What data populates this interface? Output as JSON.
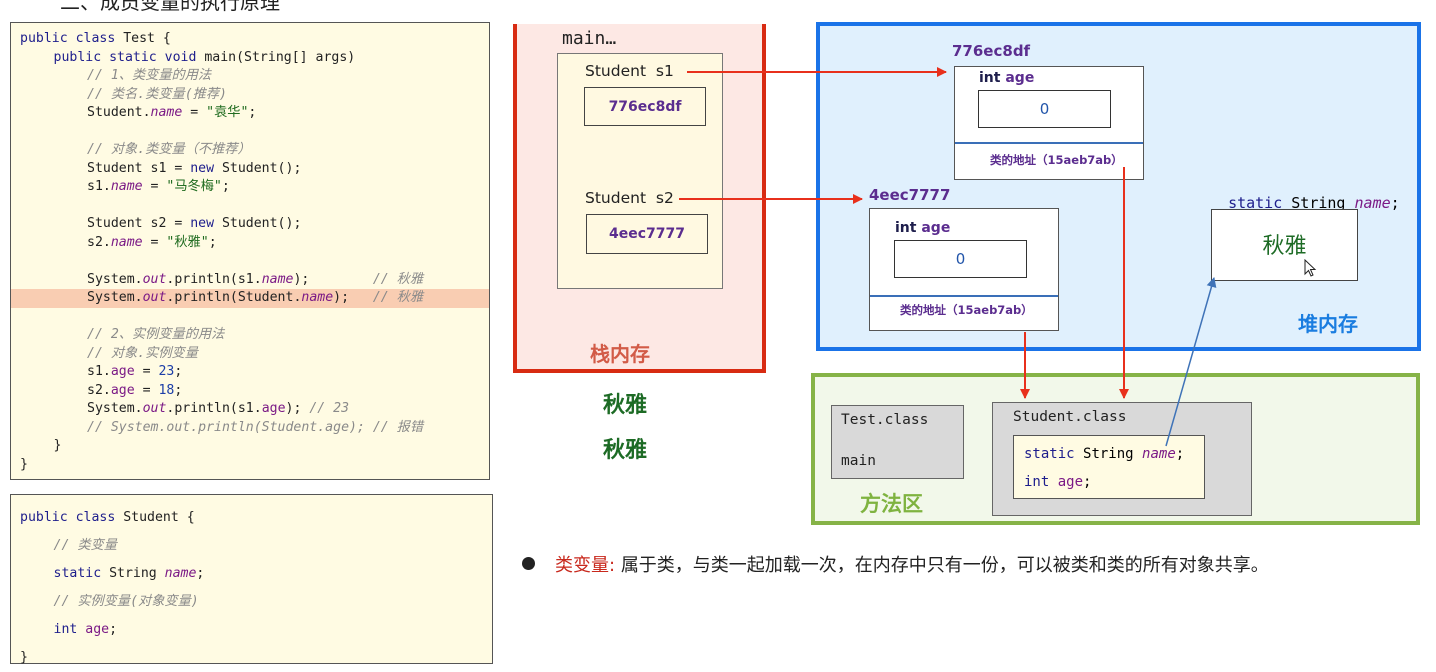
{
  "top_heading": "二、成员变量的执行原理",
  "code_test": {
    "lines": [
      {
        "indent": 0,
        "parts": [
          [
            "kw",
            "public class "
          ],
          [
            "",
            "Test {"
          ]
        ]
      },
      {
        "indent": 1,
        "parts": [
          [
            "kw",
            "public static void "
          ],
          [
            "",
            "main(String[] args)"
          ]
        ]
      },
      {
        "indent": 2,
        "parts": [
          [
            "cm",
            "// 1、类变量的用法"
          ]
        ]
      },
      {
        "indent": 2,
        "parts": [
          [
            "cm",
            "// 类名.类变量(推荐)"
          ]
        ]
      },
      {
        "indent": 2,
        "parts": [
          [
            "",
            "Student."
          ],
          [
            "fld",
            "name"
          ],
          [
            "",
            " = "
          ],
          [
            "str",
            "\"袁华\""
          ],
          [
            "",
            ";"
          ]
        ]
      },
      {
        "indent": 0,
        "parts": []
      },
      {
        "indent": 2,
        "parts": [
          [
            "cm",
            "// 对象.类变量（不推荐）"
          ]
        ]
      },
      {
        "indent": 2,
        "parts": [
          [
            "",
            "Student s1 = "
          ],
          [
            "kw",
            "new "
          ],
          [
            "",
            "Student();"
          ]
        ]
      },
      {
        "indent": 2,
        "parts": [
          [
            "",
            "s1."
          ],
          [
            "fld",
            "name"
          ],
          [
            "",
            " = "
          ],
          [
            "str",
            "\"马冬梅\""
          ],
          [
            "",
            ";"
          ]
        ]
      },
      {
        "indent": 0,
        "parts": []
      },
      {
        "indent": 2,
        "parts": [
          [
            "",
            "Student s2 = "
          ],
          [
            "kw",
            "new "
          ],
          [
            "",
            "Student();"
          ]
        ]
      },
      {
        "indent": 2,
        "parts": [
          [
            "",
            "s2."
          ],
          [
            "fld",
            "name"
          ],
          [
            "",
            " = "
          ],
          [
            "str",
            "\"秋雅\""
          ],
          [
            "",
            ";"
          ]
        ]
      },
      {
        "indent": 0,
        "parts": []
      },
      {
        "indent": 2,
        "parts": [
          [
            "",
            "System."
          ],
          [
            "fld",
            "out"
          ],
          [
            "",
            ".println(s1."
          ],
          [
            "fld",
            "name"
          ],
          [
            "",
            ");        "
          ],
          [
            "cm",
            "// 秋雅"
          ]
        ]
      },
      {
        "indent": 2,
        "highlight": true,
        "parts": [
          [
            "",
            "System."
          ],
          [
            "fld",
            "out"
          ],
          [
            "",
            ".println(Student."
          ],
          [
            "fld",
            "name"
          ],
          [
            "",
            ");   "
          ],
          [
            "cm",
            "// 秋雅"
          ]
        ]
      },
      {
        "indent": 0,
        "parts": []
      },
      {
        "indent": 2,
        "parts": [
          [
            "cm",
            "// 2、实例变量的用法"
          ]
        ]
      },
      {
        "indent": 2,
        "parts": [
          [
            "cm",
            "// 对象.实例变量"
          ]
        ]
      },
      {
        "indent": 2,
        "parts": [
          [
            "",
            "s1."
          ],
          [
            "fld2",
            "age"
          ],
          [
            "",
            " = "
          ],
          [
            "num",
            "23"
          ],
          [
            "",
            ";"
          ]
        ]
      },
      {
        "indent": 2,
        "parts": [
          [
            "",
            "s2."
          ],
          [
            "fld2",
            "age"
          ],
          [
            "",
            " = "
          ],
          [
            "num",
            "18"
          ],
          [
            "",
            ";"
          ]
        ]
      },
      {
        "indent": 2,
        "parts": [
          [
            "",
            "System."
          ],
          [
            "fld",
            "out"
          ],
          [
            "",
            ".println(s1."
          ],
          [
            "fld2",
            "age"
          ],
          [
            "",
            "); "
          ],
          [
            "cm",
            "// 23"
          ]
        ]
      },
      {
        "indent": 2,
        "parts": [
          [
            "cm",
            "// System.out.println(Student.age); // 报错"
          ]
        ]
      },
      {
        "indent": 1,
        "parts": [
          [
            "",
            "}"
          ]
        ]
      },
      {
        "indent": 0,
        "parts": [
          [
            "",
            "}"
          ]
        ]
      }
    ]
  },
  "code_student": {
    "lines": [
      {
        "indent": 0,
        "parts": [
          [
            "kw",
            "public class "
          ],
          [
            "",
            "Student {"
          ]
        ]
      },
      {
        "indent": 1,
        "parts": [
          [
            "cm",
            "// 类变量"
          ]
        ]
      },
      {
        "indent": 1,
        "parts": [
          [
            "kw",
            "static "
          ],
          [
            "",
            "String "
          ],
          [
            "fld",
            "name"
          ],
          [
            "",
            ";"
          ]
        ]
      },
      {
        "indent": 1,
        "parts": [
          [
            "cm",
            "// 实例变量(对象变量)"
          ]
        ]
      },
      {
        "indent": 1,
        "parts": [
          [
            "kw",
            "int "
          ],
          [
            "fld2",
            "age"
          ],
          [
            "",
            ";"
          ]
        ]
      },
      {
        "indent": 0,
        "parts": [
          [
            "",
            "}"
          ]
        ]
      }
    ]
  },
  "stack": {
    "frame_label": "main…",
    "vars": [
      {
        "label": "Student  s1",
        "address": "776ec8df"
      },
      {
        "label": "Student  s2",
        "address": "4eec7777"
      }
    ],
    "title": "栈内存"
  },
  "output": [
    "秋雅",
    "秋雅"
  ],
  "heap": {
    "objects": [
      {
        "address": "776ec8df",
        "field_type": "int",
        "field_name": "age",
        "value": "0",
        "class_address": "类的地址（15aeb7ab）"
      },
      {
        "address": "4eec7777",
        "field_type": "int",
        "field_name": "age",
        "value": "0",
        "class_address": "类的地址（15aeb7ab）"
      }
    ],
    "static_decl": {
      "kw": "static",
      "type": "String",
      "name": "name",
      "end": ";"
    },
    "static_value": "秋雅",
    "title": "堆内存"
  },
  "method_area": {
    "test_class": {
      "name": "Test.class",
      "member": "main"
    },
    "student_class": {
      "name": "Student.class",
      "static_line": {
        "kw": "static",
        "type": "String",
        "name": "name",
        "end": ";"
      },
      "instance_line": {
        "kw": "int",
        "name": "age",
        "end": ";"
      }
    },
    "title": "方法区"
  },
  "bullet": {
    "term": "类变量:",
    "text": "属于类，与类一起加载一次，在内存中只有一份，可以被类和类的所有对象共享。"
  },
  "colors": {
    "stack_border": "#d82b12",
    "heap_border": "#1a73e8",
    "method_border": "#86b347",
    "arrow_red": "#e8301c",
    "arrow_blue": "#3f73b8",
    "address_purple": "#5b2d8f",
    "output_green": "#1d6b25"
  }
}
